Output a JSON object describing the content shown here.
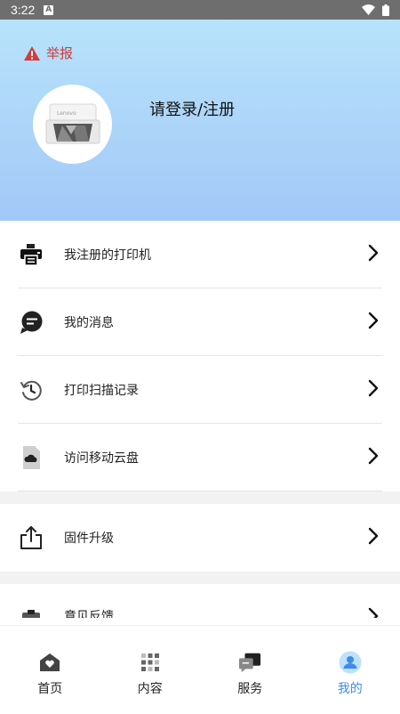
{
  "status_bar": {
    "time": "3:22"
  },
  "header": {
    "report_label": "举报",
    "login_text": "请登录/注册",
    "printer_brand": "Lenovo"
  },
  "menu": {
    "items": [
      {
        "label": "我注册的打印机",
        "icon": "printer-icon"
      },
      {
        "label": "我的消息",
        "icon": "message-icon"
      },
      {
        "label": "打印扫描记录",
        "icon": "history-icon"
      },
      {
        "label": "访问移动云盘",
        "icon": "cloud-file-icon"
      },
      {
        "label": "固件升级",
        "icon": "upload-icon"
      },
      {
        "label": "意见反馈",
        "icon": "clipboard-icon"
      }
    ]
  },
  "tabbar": {
    "tabs": [
      {
        "label": "首页",
        "icon": "home-heart-icon"
      },
      {
        "label": "内容",
        "icon": "grid-icon"
      },
      {
        "label": "服务",
        "icon": "chat-icon"
      },
      {
        "label": "我的",
        "icon": "user-icon",
        "active": true
      }
    ]
  },
  "colors": {
    "accent": "#3d8ce8",
    "report": "#d23c3c",
    "header_top": "#b8e3fb",
    "header_bottom": "#a2c8f7"
  }
}
